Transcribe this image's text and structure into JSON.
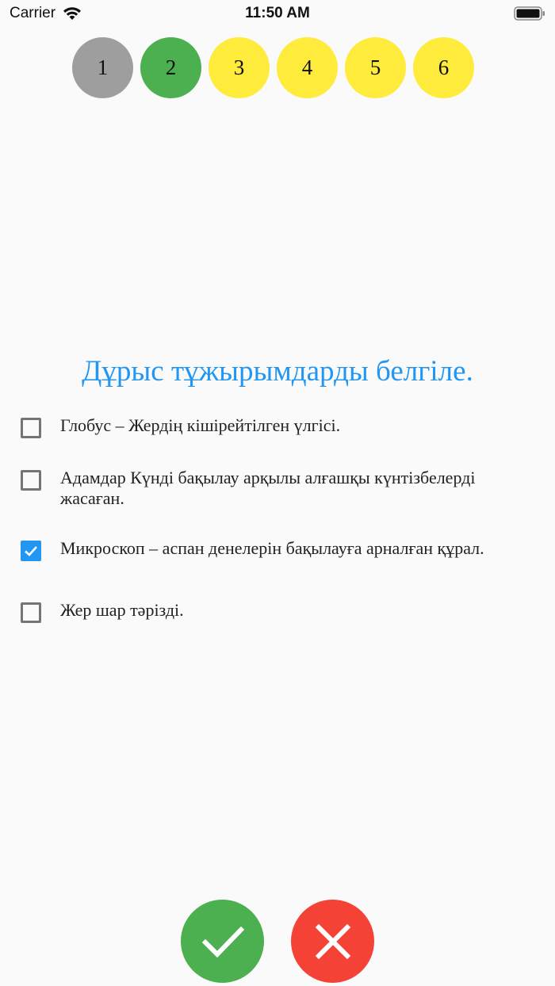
{
  "status_bar": {
    "carrier": "Carrier",
    "time": "11:50 AM"
  },
  "steps": [
    {
      "label": "1",
      "color": "#9e9e9e"
    },
    {
      "label": "2",
      "color": "#4caf50"
    },
    {
      "label": "3",
      "color": "#ffeb3b"
    },
    {
      "label": "4",
      "color": "#ffeb3b"
    },
    {
      "label": "5",
      "color": "#ffeb3b"
    },
    {
      "label": "6",
      "color": "#ffeb3b"
    }
  ],
  "question": {
    "title": "Дұрыс тұжырымдарды белгіле.",
    "options": [
      {
        "text": "Глобус – Жердің кішірейтілген үлгісі.",
        "checked": false
      },
      {
        "text": "Адамдар Күнді бақылау арқылы алғашқы күнтізбелерді жасаған.",
        "checked": false
      },
      {
        "text": "Микроскоп  – аспан денелерін бақылауға арналған құрал.",
        "checked": true
      },
      {
        "text": "Жер шар тәрізді.",
        "checked": false
      }
    ]
  },
  "colors": {
    "accent": "#2196f3",
    "confirm": "#4caf50",
    "cancel": "#f44336"
  },
  "icons": {
    "confirm": "checkmark-icon",
    "cancel": "close-icon"
  }
}
